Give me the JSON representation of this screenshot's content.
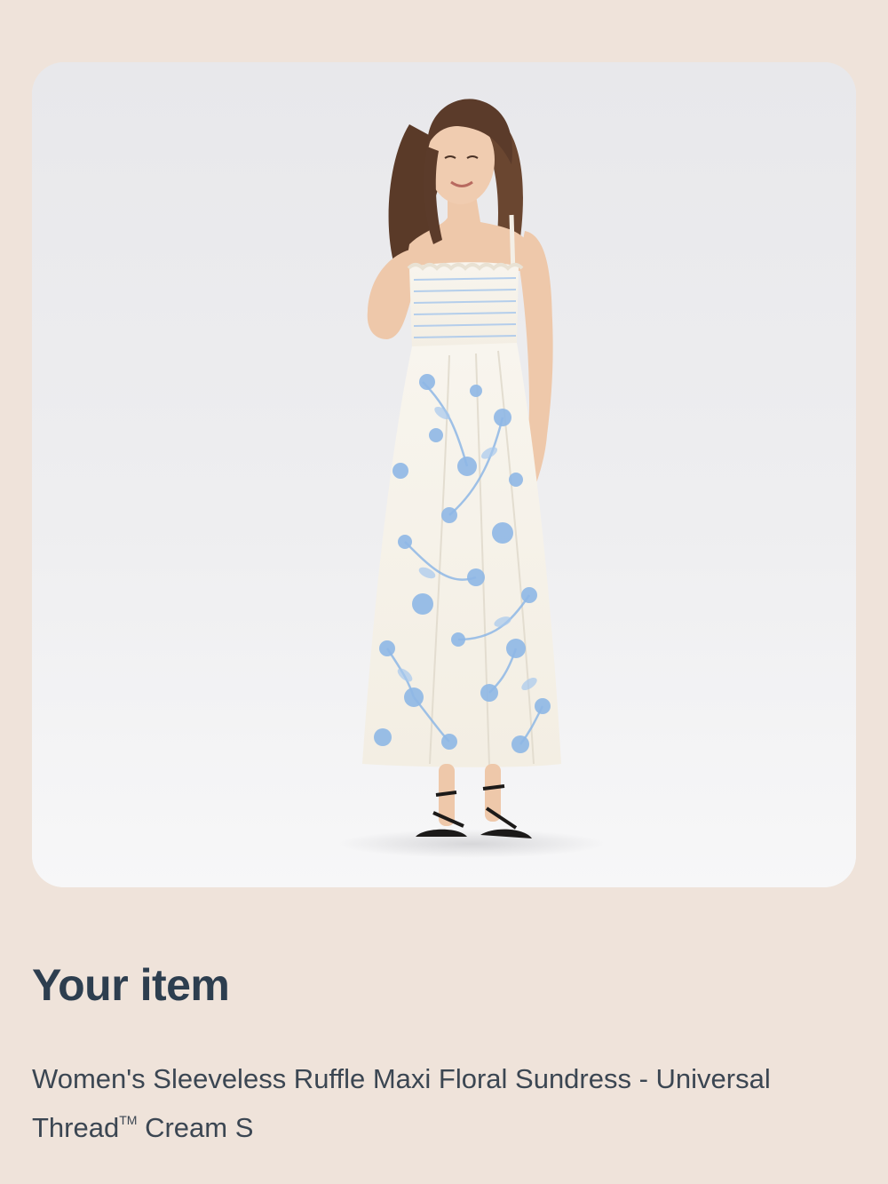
{
  "product_image": {
    "alt": "Women's Sleeveless Ruffle Maxi Floral Sundress - Universal Thread Cream S",
    "colors": {
      "card_background": "#ececee",
      "dress_base": "#f7f3ea",
      "floral_print": "#8fb8e6",
      "hair": "#5a3a28",
      "skin": "#eec8aa",
      "sandals": "#1c1a19"
    }
  },
  "section": {
    "title": "Your item"
  },
  "item": {
    "name_line1": "Women's Sleeveless Ruffle Maxi Floral Sundress - Universal",
    "name_line2_prefix": "Thread",
    "trademark": "TM",
    "name_line2_suffix": " Cream S"
  },
  "page": {
    "background": "#efe3da",
    "title_color": "#2d3e4f",
    "text_color": "#3b4652"
  }
}
